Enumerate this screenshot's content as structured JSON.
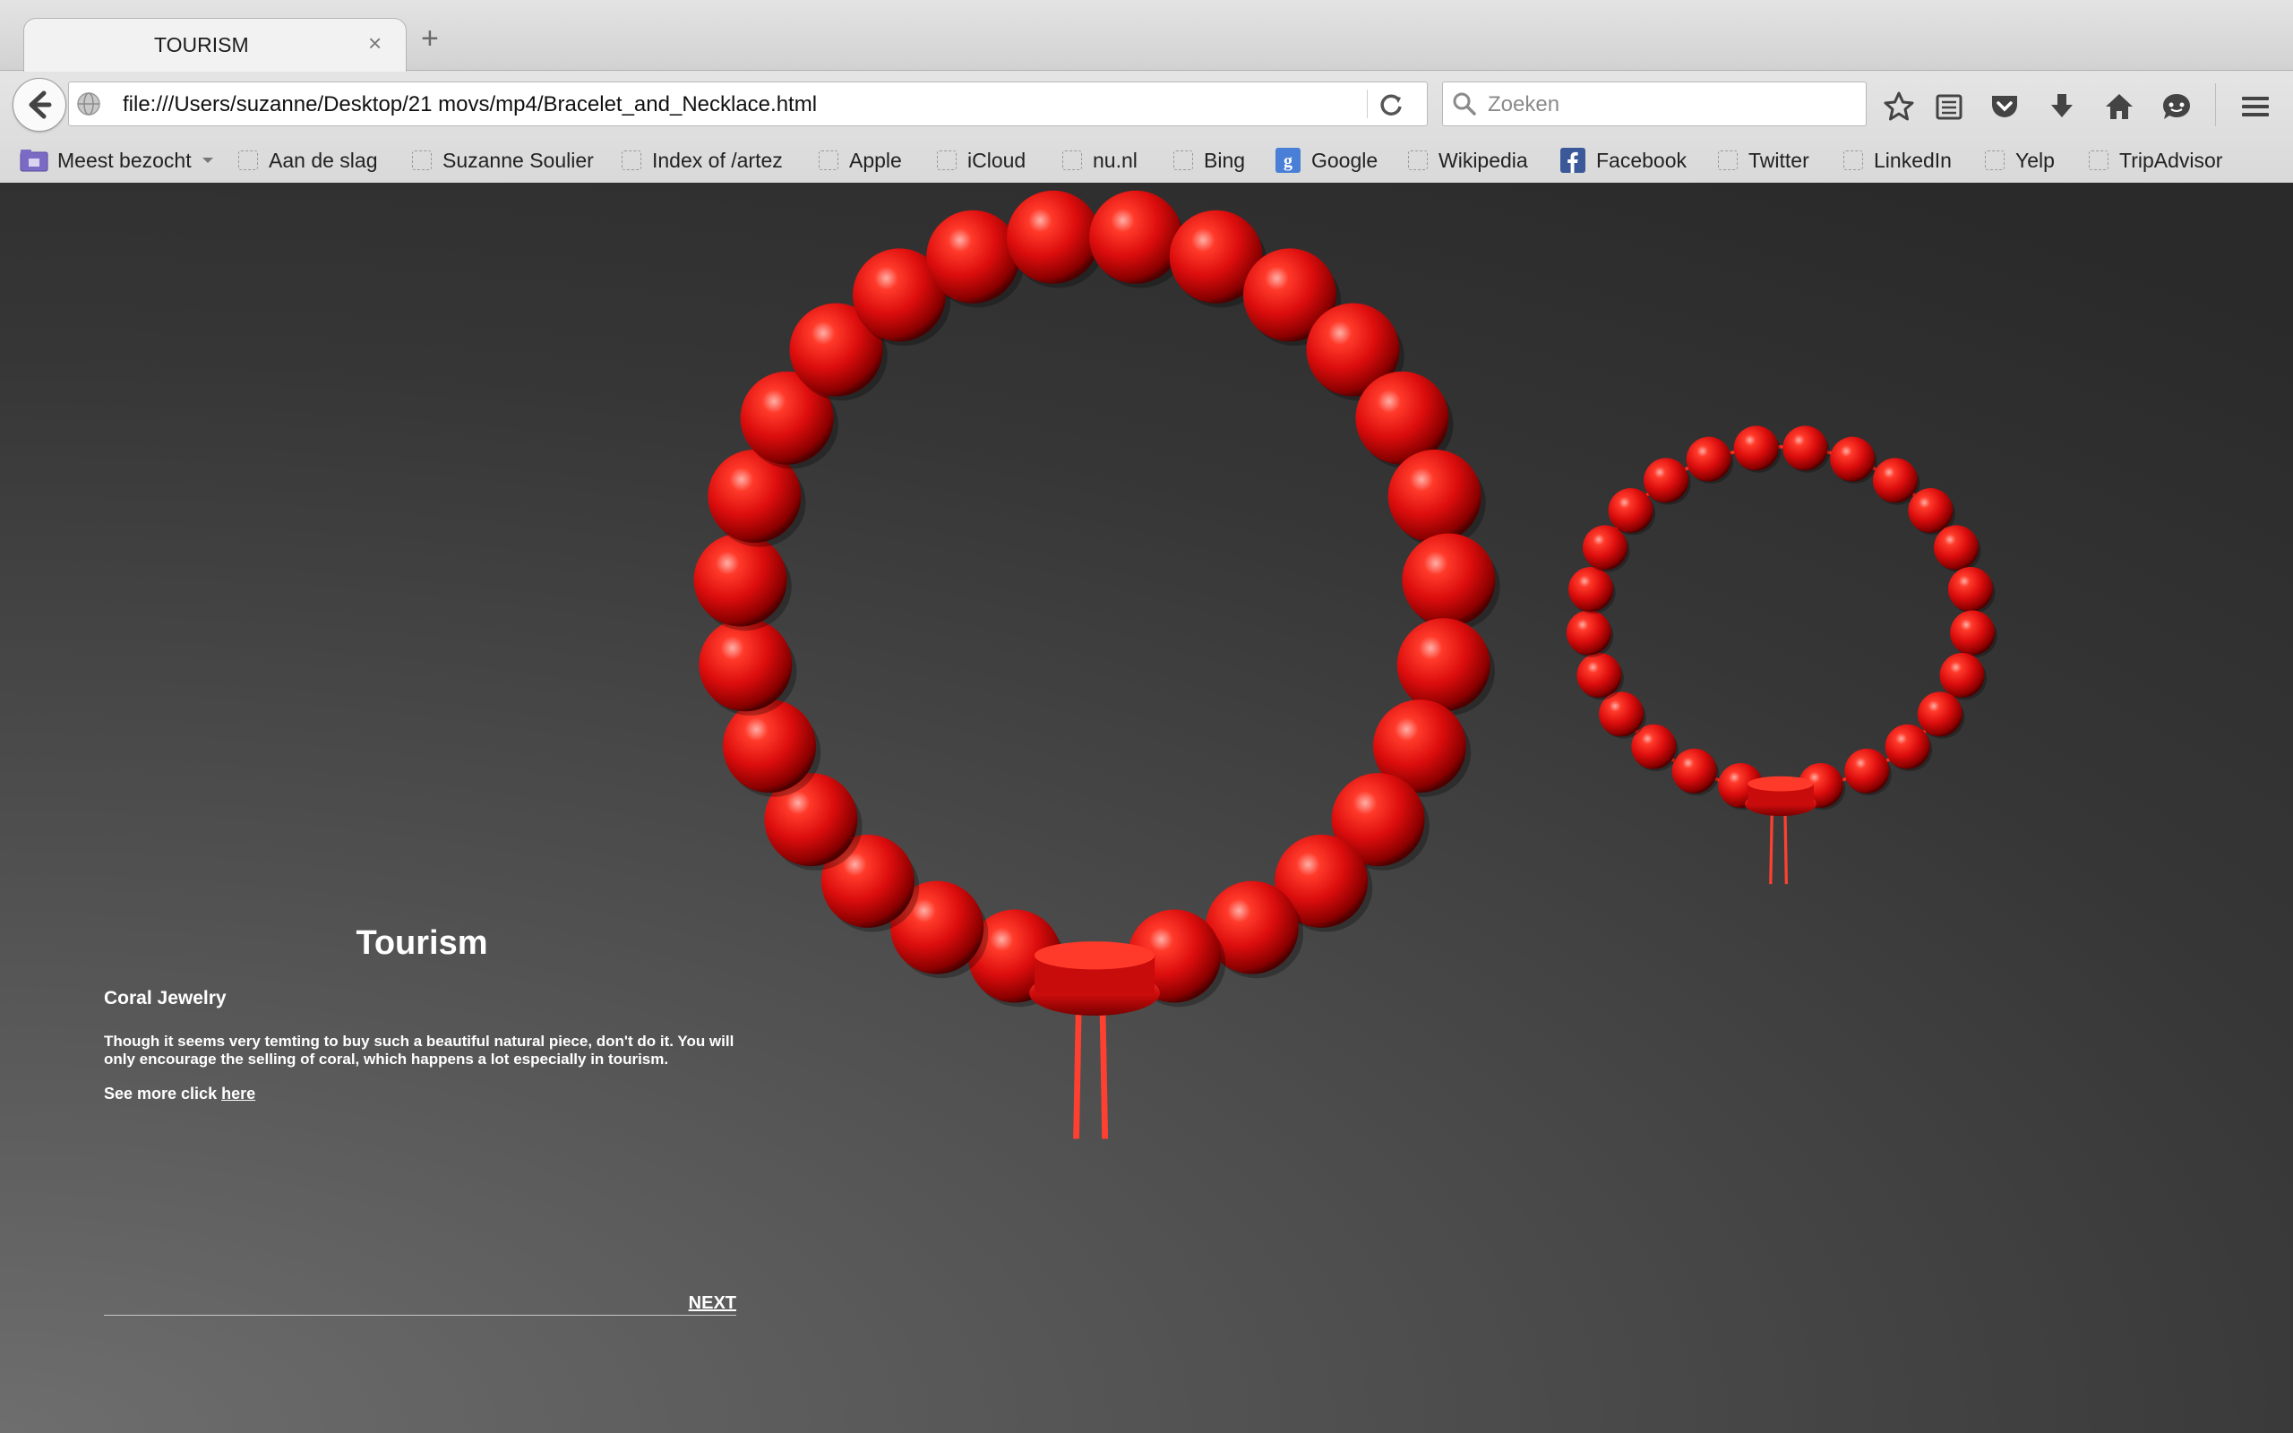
{
  "browser": {
    "tab": {
      "title": "TOURISM",
      "close": "×"
    },
    "new_tab": "+",
    "url": "file:///Users/suzanne/Desktop/21 movs/mp4/Bracelet_and_Necklace.html",
    "search_placeholder": "Zoeken",
    "toolbar_icons": [
      "star-icon",
      "reading-list-icon",
      "pocket-icon",
      "download-icon",
      "home-icon",
      "chat-icon",
      "menu-icon"
    ],
    "bookmarks": [
      {
        "label": "Meest bezocht",
        "icon": "folder-icon"
      },
      {
        "label": "Aan de slag",
        "icon": "page-icon"
      },
      {
        "label": "Suzanne Soulier",
        "icon": "page-icon"
      },
      {
        "label": "Index of /artez",
        "icon": "page-icon"
      },
      {
        "label": "Apple",
        "icon": "page-icon"
      },
      {
        "label": "iCloud",
        "icon": "page-icon"
      },
      {
        "label": "nu.nl",
        "icon": "page-icon"
      },
      {
        "label": "Bing",
        "icon": "page-icon"
      },
      {
        "label": "Google",
        "icon": "google-icon"
      },
      {
        "label": "Wikipedia",
        "icon": "page-icon"
      },
      {
        "label": "Facebook",
        "icon": "facebook-icon"
      },
      {
        "label": "Twitter",
        "icon": "page-icon"
      },
      {
        "label": "LinkedIn",
        "icon": "page-icon"
      },
      {
        "label": "Yelp",
        "icon": "page-icon"
      },
      {
        "label": "TripAdvisor",
        "icon": "page-icon"
      }
    ]
  },
  "page": {
    "title": "Tourism",
    "subtitle": "Coral Jewelry",
    "body": "Though it seems very temting to buy such a beautiful natural piece, don't do it. You will only encourage the selling of coral, which happens a lot especially in tourism.",
    "more_prefix": "See more click ",
    "more_link": "here",
    "next": "NEXT"
  },
  "colors": {
    "bead": "#e01010",
    "accent_blue": "#4a7fd8",
    "facebook": "#3b5998"
  }
}
